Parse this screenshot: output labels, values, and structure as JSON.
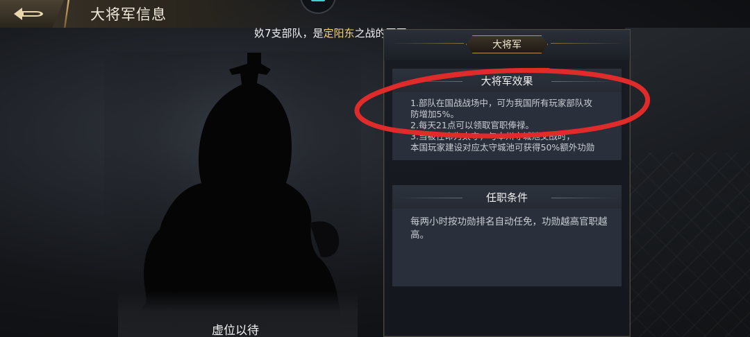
{
  "header": {
    "back_icon": "back-arrow-icon",
    "title": "大将军信息"
  },
  "subtitle": {
    "prefix": "奺7支部队，是",
    "highlight": "定阳东",
    "suffix": "之战的冠军",
    "highlight_color": "#f6d46a"
  },
  "panel": {
    "tab_label": "大将军",
    "effect": {
      "heading": "大将军效果",
      "lines": [
        "1.部队在国战战场中，可为我国所有玩家部队攻",
        "防增加5%。",
        "2.每天21点可以领取官职俸禄。",
        "3.当被任命为太守，与本州守城池交战时，",
        "本国玩家建设对应太守城池可获得50%额外功勋"
      ]
    },
    "condition": {
      "heading": "任职条件",
      "text": "每两小时按功勋排名自动任免，功勋越高官职越高。"
    }
  },
  "nameplate": {
    "label": "虚位以待"
  },
  "annotation": {
    "color": "#e02b2b",
    "shape": "hand-drawn ellipse"
  }
}
